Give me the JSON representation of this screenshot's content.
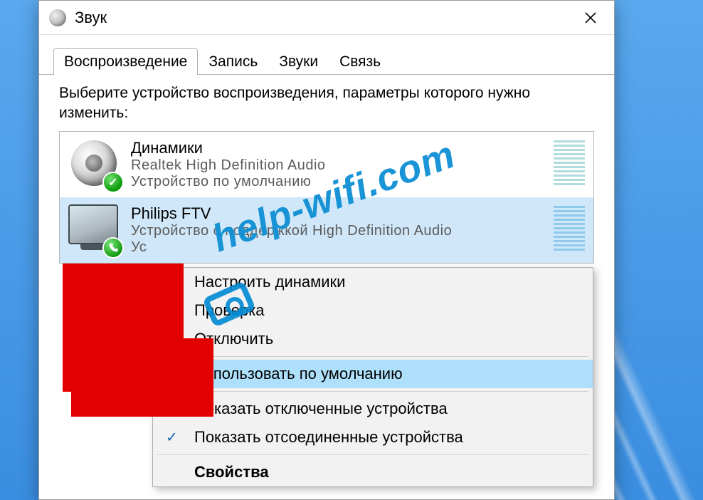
{
  "window": {
    "title": "Звук"
  },
  "tabs": [
    {
      "label": "Воспроизведение"
    },
    {
      "label": "Запись"
    },
    {
      "label": "Звуки"
    },
    {
      "label": "Связь"
    }
  ],
  "instruction": "Выберите устройство воспроизведения, параметры которого нужно изменить:",
  "devices": [
    {
      "name": "Динамики",
      "line2": "Realtek High Definition Audio",
      "line3": "Устройство по умолчанию",
      "badge": "check"
    },
    {
      "name": "Philips FTV",
      "line2": "Устройство с поддержкой High Definition Audio",
      "line3": "Ус",
      "badge": "phone"
    }
  ],
  "context_menu": {
    "items": [
      {
        "label": "Настроить динамики"
      },
      {
        "label": "Проверка"
      },
      {
        "label": "Отключить"
      }
    ],
    "default_item": "Использовать по умолчанию",
    "items2": [
      {
        "label": "Показать отключенные устройства",
        "checked": false
      },
      {
        "label": "Показать отсоединенные устройства",
        "checked": true
      }
    ],
    "properties": "Свойства"
  },
  "watermark": "help-wifi.com"
}
